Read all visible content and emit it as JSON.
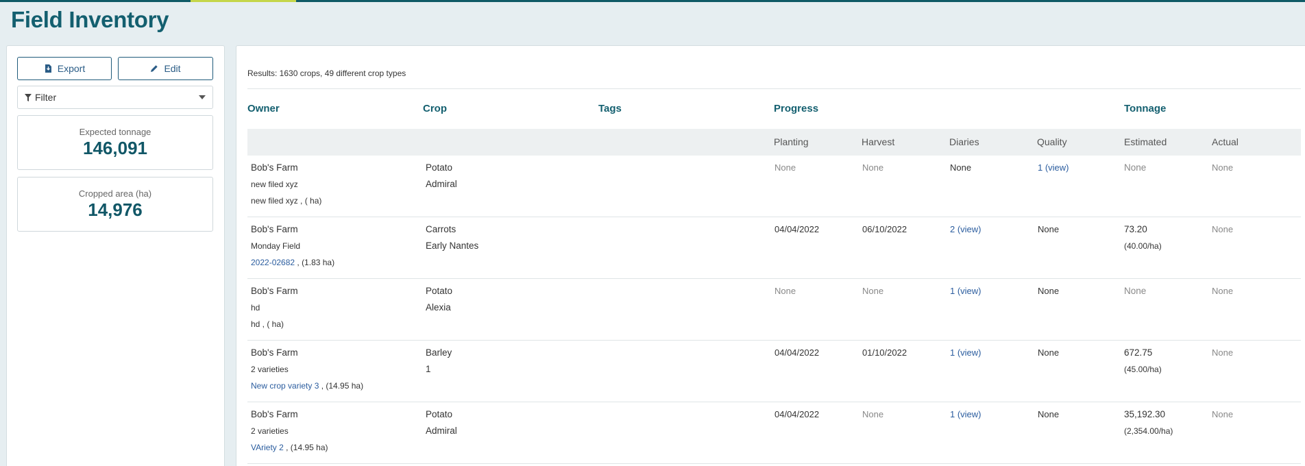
{
  "page_title": "Field Inventory",
  "toolbar": {
    "export_label": "Export",
    "edit_label": "Edit",
    "filter_label": "Filter"
  },
  "stats": {
    "expected_tonnage_label": "Expected tonnage",
    "expected_tonnage_value": "146,091",
    "cropped_area_label": "Cropped area (ha)",
    "cropped_area_value": "14,976"
  },
  "results_text": "Results: 1630 crops, 49 different crop types",
  "headers": {
    "owner": "Owner",
    "crop": "Crop",
    "tags": "Tags",
    "progress": "Progress",
    "tonnage": "Tonnage"
  },
  "subheaders": {
    "planting": "Planting",
    "harvest": "Harvest",
    "diaries": "Diaries",
    "quality": "Quality",
    "estimated": "Estimated",
    "actual": "Actual"
  },
  "rows": [
    {
      "owner": "Bob's Farm",
      "field": "new filed xyz",
      "field_link": "",
      "field_suffix": "new filed xyz , ( ha)",
      "crop": "Potato",
      "variety": "Admiral",
      "planting": "None",
      "harvest": "None",
      "diaries": "None",
      "quality": "1 (view)",
      "estimated": "None",
      "estimated_rate": "",
      "actual": "None"
    },
    {
      "owner": "Bob's Farm",
      "field": "Monday Field",
      "field_link": "2022-02682",
      "field_suffix": " , (1.83 ha)",
      "crop": "Carrots",
      "variety": "Early Nantes",
      "planting": "04/04/2022",
      "harvest": "06/10/2022",
      "diaries": "2 (view)",
      "quality": "None",
      "estimated": "73.20",
      "estimated_rate": "(40.00/ha)",
      "actual": "None"
    },
    {
      "owner": "Bob's Farm",
      "field": "hd",
      "field_link": "",
      "field_suffix": "hd , ( ha)",
      "crop": "Potato",
      "variety": "Alexia",
      "planting": "None",
      "harvest": "None",
      "diaries": "1 (view)",
      "quality": "None",
      "estimated": "None",
      "estimated_rate": "",
      "actual": "None"
    },
    {
      "owner": "Bob's Farm",
      "field": "2 varieties",
      "field_link": "New crop variety 3",
      "field_suffix": " , (14.95 ha)",
      "crop": "Barley",
      "variety": "1",
      "planting": "04/04/2022",
      "harvest": "01/10/2022",
      "diaries": "1 (view)",
      "quality": "None",
      "estimated": "672.75",
      "estimated_rate": "(45.00/ha)",
      "actual": "None"
    },
    {
      "owner": "Bob's Farm",
      "field": "2 varieties",
      "field_link": "VAriety 2",
      "field_suffix": " , (14.95 ha)",
      "crop": "Potato",
      "variety": "Admiral",
      "planting": "04/04/2022",
      "harvest": "None",
      "diaries": "1 (view)",
      "quality": "None",
      "estimated": "35,192.30",
      "estimated_rate": "(2,354.00/ha)",
      "actual": "None"
    }
  ],
  "colors": {
    "title": "#135f6f",
    "accent_bar": "#c5d64a",
    "link": "#2a5c9e"
  }
}
